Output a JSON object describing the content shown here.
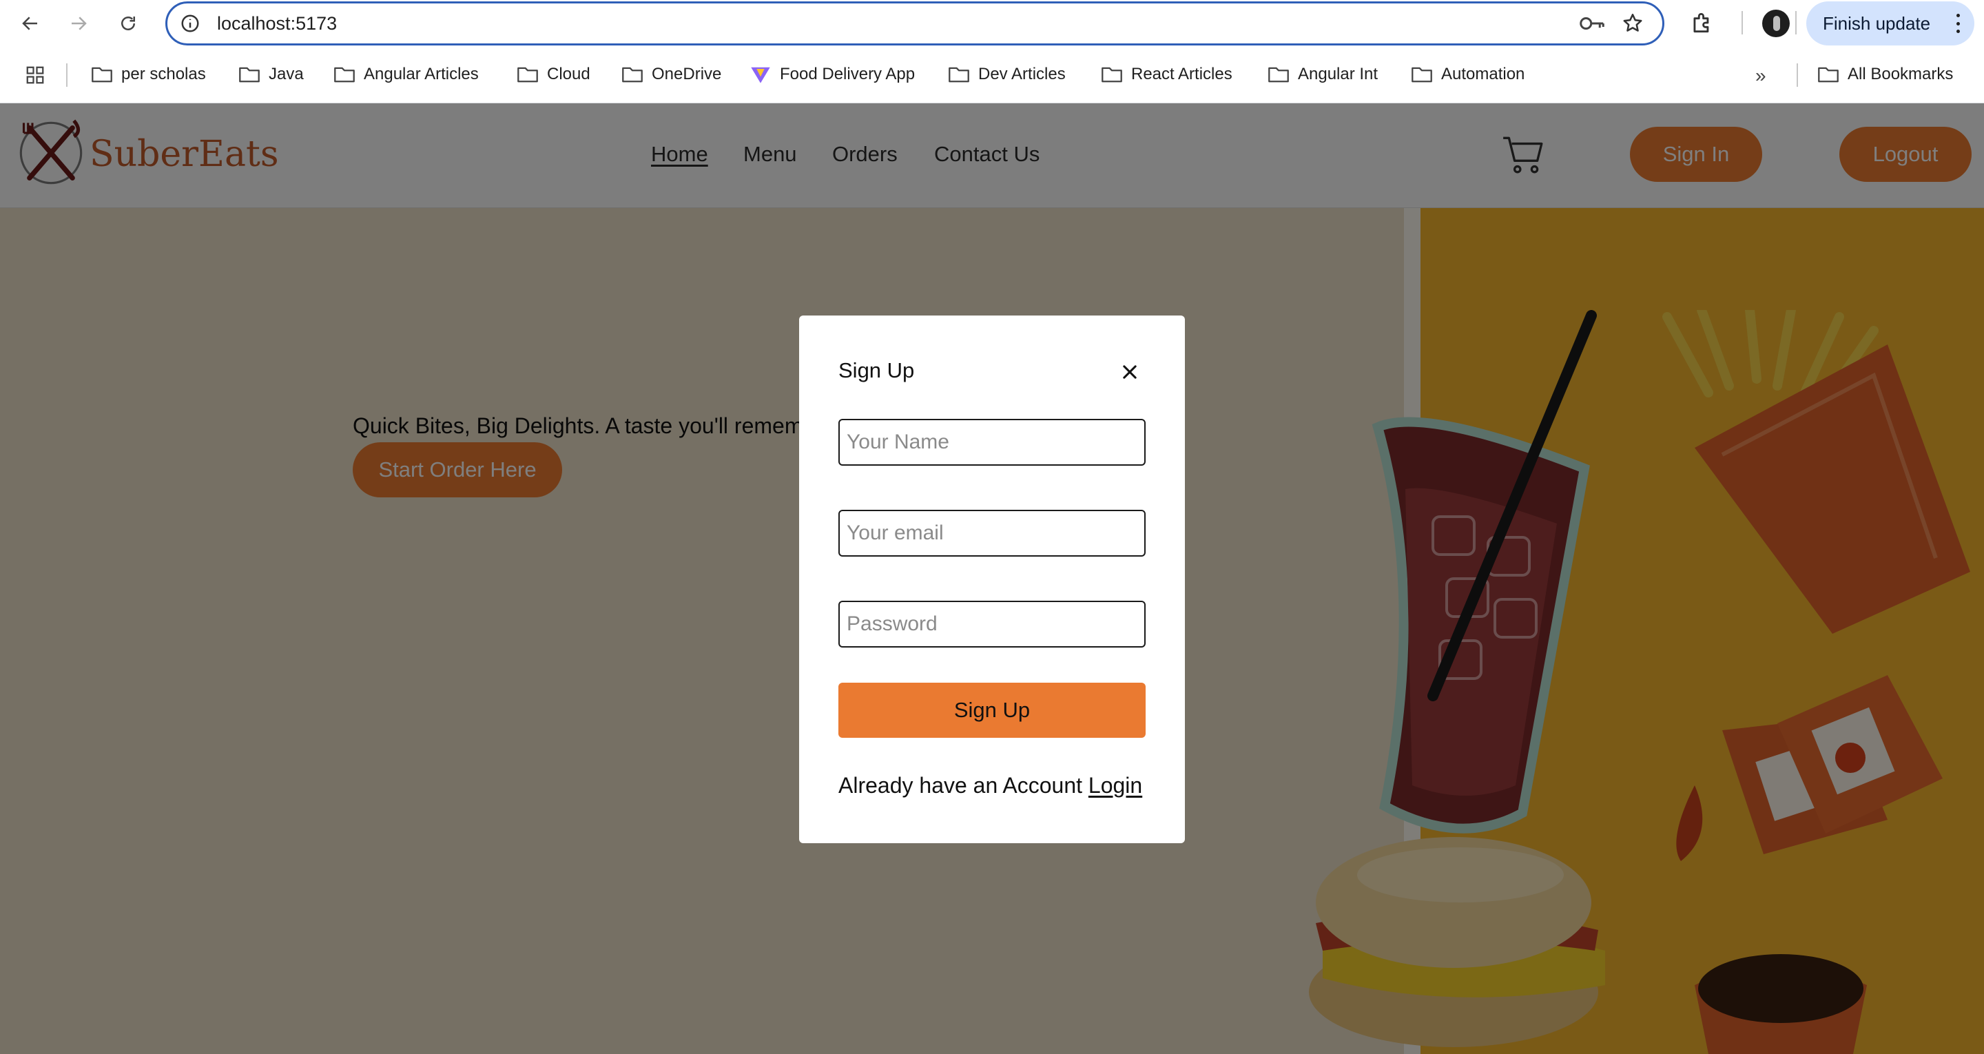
{
  "browser": {
    "url": "localhost:5173",
    "update_button": "Finish update",
    "bookmarks": [
      "per scholas",
      "Java",
      "Angular Articles",
      "Cloud",
      "OneDrive",
      "Food Delivery App",
      "Dev Articles",
      "React Articles",
      "Angular Int",
      "Automation"
    ],
    "all_bookmarks": "All Bookmarks"
  },
  "site": {
    "brand": "SuberEats",
    "nav": [
      "Home",
      "Menu",
      "Orders",
      "Contact Us"
    ],
    "active_nav": "Home",
    "sign_in": "Sign In",
    "logout": "Logout",
    "tagline": "Quick Bites, Big Delights. A taste you'll remem",
    "cta": "Start Order Here",
    "accent_color": "#ea7a31"
  },
  "modal": {
    "title": "Sign Up",
    "name_placeholder": "Your Name",
    "email_placeholder": "Your email",
    "password_placeholder": "Password",
    "submit": "Sign Up",
    "already_text": "Already have an Account",
    "login_link": "Login"
  }
}
